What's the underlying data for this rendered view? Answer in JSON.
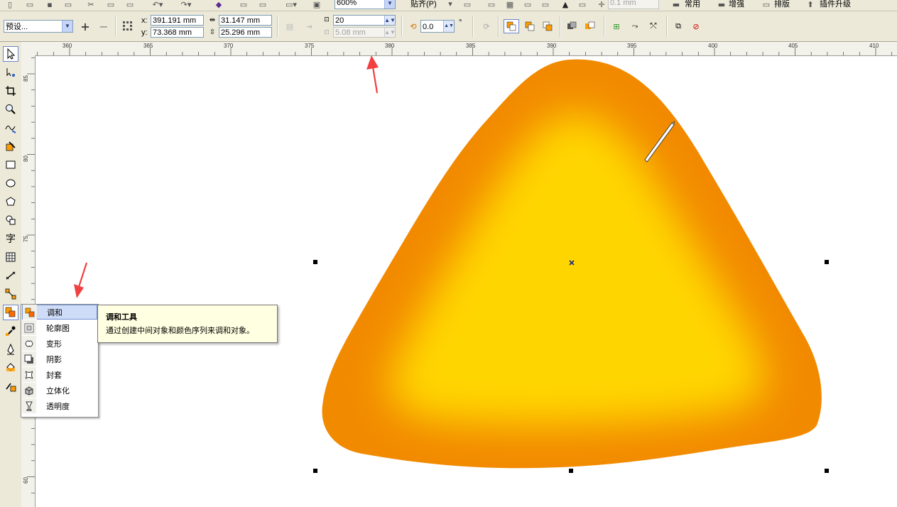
{
  "topbar": {
    "zoom_value": "600%",
    "snap_label": "贴齐(P)",
    "nudge_value": "0.1 mm",
    "menus": [
      "常用",
      "增强",
      "排版",
      "插件升级"
    ]
  },
  "propbar": {
    "preset_value": "预设...",
    "x_label": "x:",
    "x_value": "391.191 mm",
    "y_label": "y:",
    "y_value": "73.368 mm",
    "width_value": "31.147 mm",
    "height_value": "25.296 mm",
    "steps_value": "20",
    "spacing_value": "5.08 mm",
    "angle_value": "0.0",
    "angle_unit": "°"
  },
  "ruler": {
    "top_ticks": [
      "360",
      "365",
      "370",
      "375",
      "380",
      "385",
      "390",
      "395",
      "400",
      "405",
      "410"
    ],
    "left_ticks": [
      "85",
      "80",
      "75",
      "70",
      "65",
      "60"
    ]
  },
  "flyout": {
    "items": [
      {
        "label": "调和",
        "icon": "blend-icon"
      },
      {
        "label": "轮廓图",
        "icon": "contour-icon"
      },
      {
        "label": "变形",
        "icon": "distort-icon"
      },
      {
        "label": "阴影",
        "icon": "shadow-icon"
      },
      {
        "label": "封套",
        "icon": "envelope-icon"
      },
      {
        "label": "立体化",
        "icon": "extrude-icon"
      },
      {
        "label": "透明度",
        "icon": "transparency-icon"
      }
    ]
  },
  "tooltip": {
    "title": "调和工具",
    "body": "通过创建中间对象和颜色序列来调和对象。"
  },
  "colors": {
    "shape_inner": "#ffd500",
    "shape_outer": "#f28a00",
    "ui_face": "#ece9d8",
    "annotation_arrow": "#f04040"
  }
}
